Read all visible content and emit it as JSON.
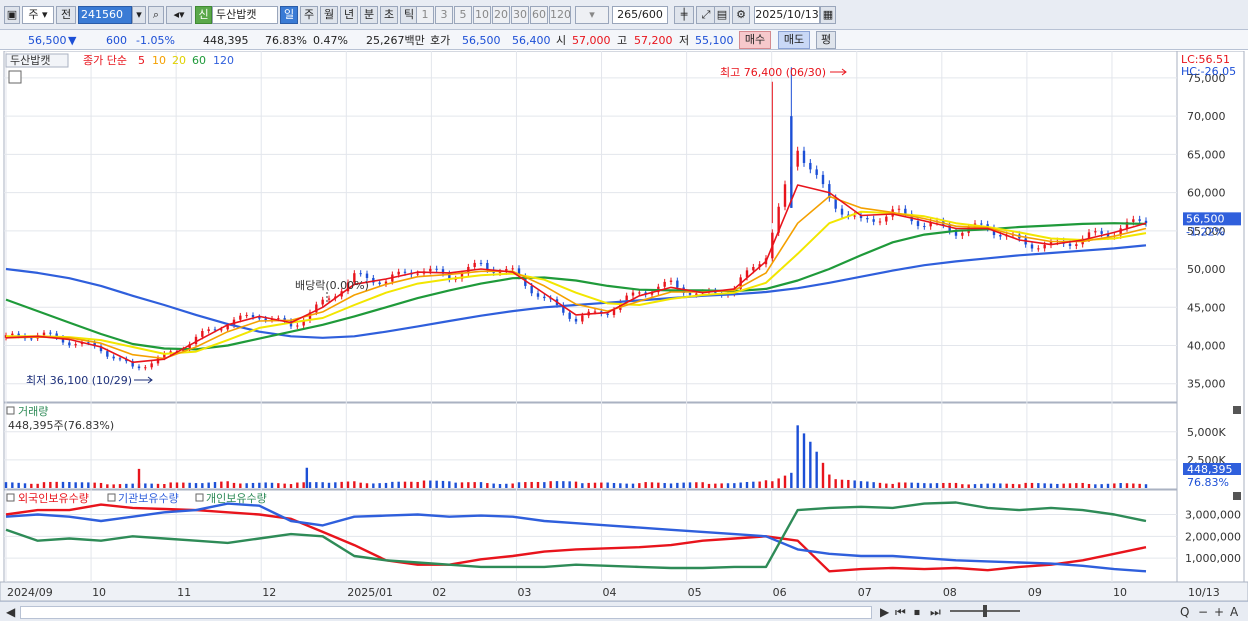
{
  "toolbar": {
    "period_type": "주",
    "prefix": "전",
    "stock_code": "241560",
    "new_badge": "신",
    "stock_name": "두산밥캣",
    "period_tabs": [
      "일",
      "주",
      "월",
      "년",
      "분",
      "초",
      "틱"
    ],
    "active_period": "일",
    "tick_options": [
      "1",
      "3",
      "5",
      "10",
      "20",
      "30",
      "60",
      "120"
    ],
    "count_value": "265",
    "count_total": "/600",
    "date": "2025/10/13"
  },
  "info": {
    "price": "56,500",
    "arrow": "▼",
    "change": "600",
    "change_pct": "-1.05%",
    "volume": "448,395",
    "vol_ratio": "76.83%",
    "turnover": "0.47%",
    "amount": "25,267백만",
    "ask_label": "호가",
    "ask": "56,500",
    "bid": "56,400",
    "open_label": "시",
    "open": "57,000",
    "high_label": "고",
    "high": "57,200",
    "low_label": "저",
    "low": "55,100",
    "buy_label": "매수",
    "sell_label": "매도",
    "avg_label": "평"
  },
  "colors": {
    "up": "#e8141c",
    "down": "#1c4fd6",
    "ma5": "#e8141c",
    "ma10": "#f4a000",
    "ma20": "#f2e600",
    "ma60": "#1f9a3a",
    "ma120": "#2f5fdc",
    "foreign": "#e8141c",
    "institution": "#2f5fdc",
    "individual": "#2e8b57"
  },
  "chart_data": [
    {
      "type": "line",
      "panel": "price",
      "legend_title": "두산밥캣",
      "legend_prefix": "종가 단순",
      "ma_periods": [
        "5",
        "10",
        "20",
        "60",
        "120"
      ],
      "yticks": [
        "35,000",
        "40,000",
        "45,000",
        "50,000",
        "55,000",
        "60,000",
        "65,000",
        "70,000",
        "75,000"
      ],
      "ylim": [
        33000,
        78000
      ],
      "lc_label": "LC:56.51",
      "hc_label": "HC:-26.05",
      "last_price_label": "56,500",
      "last_change_label": "-1.22%",
      "high_annotation": "최고 76,400 (06/30)",
      "low_annotation": "최저 36,100 (10/29)",
      "dividend_annotation": "배당락(0.00%)",
      "x": [
        "2024/09",
        "10",
        "11",
        "12",
        "2025/01",
        "02",
        "03",
        "04",
        "05",
        "06",
        "07",
        "08",
        "09",
        "10"
      ],
      "close": [
        41000,
        41500,
        40500,
        39500,
        37000,
        38500,
        41000,
        43000,
        44000,
        42500,
        45500,
        49000,
        48500,
        50000,
        49000,
        50500,
        49500,
        46000,
        43500,
        44500,
        47000,
        48000,
        46500,
        47500,
        52000,
        66000,
        59000,
        56000,
        57500,
        56000,
        55000,
        55500,
        53500,
        53000,
        54000,
        55000,
        56500
      ],
      "ma5": [
        41000,
        41200,
        40800,
        39800,
        37800,
        38200,
        40500,
        42700,
        43800,
        43000,
        45000,
        48000,
        48700,
        49600,
        49500,
        50000,
        49600,
        46800,
        44000,
        44300,
        46500,
        47600,
        46900,
        47400,
        51000,
        61000,
        60000,
        57000,
        57200,
        56300,
        55300,
        55300,
        53800,
        53200,
        53800,
        54800,
        56000
      ],
      "ma10": [
        41000,
        41100,
        41000,
        40300,
        38800,
        38300,
        39800,
        41800,
        43200,
        43300,
        44400,
        46600,
        48000,
        49000,
        49300,
        49700,
        49700,
        47800,
        45400,
        44500,
        45800,
        47000,
        47000,
        47200,
        49500,
        56000,
        59500,
        58000,
        57400,
        56600,
        55600,
        55400,
        54300,
        53600,
        53600,
        54300,
        55300
      ],
      "ma20": [
        41200,
        41200,
        41100,
        40700,
        39800,
        38900,
        39200,
        40700,
        42300,
        43000,
        43600,
        45300,
        46900,
        48100,
        48700,
        49200,
        49400,
        48600,
        46900,
        45500,
        45300,
        46100,
        46600,
        46900,
        48200,
        52000,
        56000,
        57500,
        57300,
        56900,
        56000,
        55500,
        54800,
        54000,
        53800,
        54000,
        54700
      ],
      "ma60": [
        46000,
        44500,
        43000,
        41500,
        40200,
        39600,
        39500,
        40000,
        40900,
        41800,
        42700,
        43800,
        45000,
        46200,
        47200,
        48100,
        48800,
        48900,
        48500,
        47800,
        47300,
        47200,
        47200,
        47100,
        47400,
        48500,
        50000,
        51800,
        53500,
        54500,
        55000,
        55200,
        55500,
        55700,
        55900,
        56000,
        55900
      ],
      "ma120": [
        50000,
        49500,
        48800,
        47800,
        46500,
        45300,
        44000,
        42800,
        41800,
        41200,
        41000,
        41200,
        41800,
        42500,
        43200,
        43900,
        44500,
        45000,
        45300,
        45600,
        45900,
        46200,
        46500,
        46700,
        47000,
        47500,
        48200,
        49000,
        49800,
        50500,
        51000,
        51400,
        51800,
        52100,
        52400,
        52700,
        53100
      ]
    },
    {
      "type": "bar",
      "panel": "volume",
      "legend_title": "거래량",
      "info_label": "448,395주(76.83%)",
      "yticks": [
        "2,500K",
        "5,000K"
      ],
      "ylim": [
        0,
        7200000
      ],
      "last_label": "448,395",
      "last_pct": "76.83%",
      "values": [
        550000,
        500000,
        600000,
        450000,
        420000,
        500000,
        480000,
        600000,
        520000,
        480000,
        550000,
        600000,
        520000,
        700000,
        620000,
        530000,
        480000,
        650000,
        580000,
        500000,
        540000,
        480000,
        520000,
        450000,
        900000,
        6400000,
        1200000,
        650000,
        500000,
        480000,
        450000,
        430000,
        470000,
        420000,
        450000,
        460000,
        448395
      ],
      "spikes": [
        {
          "x": "11",
          "value": 1700000
        },
        {
          "x": "12",
          "value": 1800000
        }
      ]
    },
    {
      "type": "line",
      "panel": "holdings",
      "legend": [
        "외국인보유수량",
        "기관보유수량",
        "개인보유수량"
      ],
      "yticks": [
        "1,000,000",
        "2,000,000",
        "3,000,000"
      ],
      "ylim": [
        0,
        3800000
      ],
      "series": [
        {
          "name": "외국인보유수량",
          "values": [
            3000000,
            3200000,
            3200000,
            3450000,
            3300000,
            3250000,
            3200000,
            3100000,
            3000000,
            2800000,
            2200000,
            1600000,
            900000,
            700000,
            700000,
            950000,
            1100000,
            1300000,
            1400000,
            1450000,
            1500000,
            1600000,
            1800000,
            1900000,
            2000000,
            1800000,
            400000,
            500000,
            550000,
            500000,
            550000,
            450000,
            600000,
            700000,
            900000,
            1200000,
            1500000
          ]
        },
        {
          "name": "기관보유수량",
          "values": [
            2900000,
            3000000,
            2900000,
            2700000,
            2900000,
            3100000,
            3200000,
            3500000,
            3400000,
            2700000,
            2500000,
            2900000,
            2950000,
            3000000,
            2900000,
            2950000,
            2900000,
            2700000,
            2600000,
            2500000,
            2400000,
            2300000,
            2200000,
            2100000,
            2000000,
            1400000,
            1200000,
            1100000,
            1100000,
            1000000,
            900000,
            850000,
            800000,
            750000,
            650000,
            500000,
            400000
          ]
        },
        {
          "name": "개인보유수량",
          "values": [
            2300000,
            1800000,
            1900000,
            1800000,
            2000000,
            1900000,
            1800000,
            1700000,
            1900000,
            2100000,
            2000000,
            1100000,
            900000,
            800000,
            700000,
            600000,
            600000,
            600000,
            700000,
            650000,
            600000,
            550000,
            550000,
            600000,
            600000,
            3200000,
            3300000,
            3350000,
            3300000,
            3500000,
            3550000,
            3300000,
            3200000,
            3300000,
            3200000,
            3000000,
            2700000
          ]
        }
      ]
    }
  ],
  "status": {
    "right_date": "10/13",
    "controls": [
      "◀",
      "▶",
      "⏮",
      "⏹",
      "⏭",
      "Q",
      "−",
      "+",
      "A"
    ]
  }
}
